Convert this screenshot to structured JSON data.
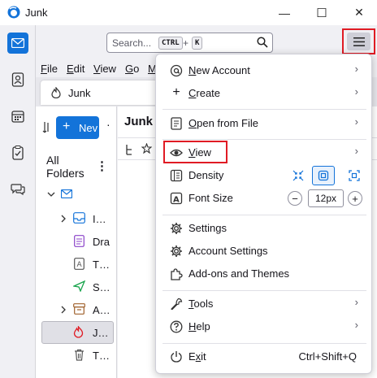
{
  "window": {
    "title": "Junk",
    "minimize_glyph": "—",
    "maximize_glyph": "☐",
    "close_glyph": "✕"
  },
  "search": {
    "placeholder": "Search...",
    "key1": "CTRL",
    "plus": "+",
    "key2": "K"
  },
  "menubar": [
    {
      "label": "File",
      "mnemonic": "F",
      "rest": "ile"
    },
    {
      "label": "Edit",
      "mnemonic": "E",
      "rest": "dit"
    },
    {
      "label": "View",
      "mnemonic": "V",
      "rest": "iew"
    },
    {
      "label": "Go",
      "mnemonic": "G",
      "rest": "o"
    },
    {
      "label": "M",
      "mnemonic": "M",
      "rest": ""
    }
  ],
  "tab": {
    "label": "Junk"
  },
  "folderpane": {
    "new_message": "Nev",
    "all_folders": "All Folders",
    "more": "⋮",
    "dot": "·",
    "folders": [
      {
        "name": "I…",
        "icon": "inbox-icon"
      },
      {
        "name": "Dra",
        "icon": "drafts-icon"
      },
      {
        "name": "T…",
        "icon": "templates-icon"
      },
      {
        "name": "S…",
        "icon": "sent-icon"
      },
      {
        "name": "A…",
        "icon": "archive-icon"
      },
      {
        "name": "J…",
        "icon": "junk-icon"
      },
      {
        "name": "T…",
        "icon": "trash-icon"
      }
    ]
  },
  "thread": {
    "title": "Junk"
  },
  "appmenu": {
    "new_account": {
      "pre": "",
      "mn": "N",
      "post": "ew Account"
    },
    "create": {
      "pre": "",
      "mn": "C",
      "post": "reate"
    },
    "open_from_file": {
      "pre": "",
      "mn": "O",
      "post": "pen from File"
    },
    "view": {
      "pre": "",
      "mn": "V",
      "post": "iew"
    },
    "density": "Density",
    "font_size": "Font Size",
    "font_size_value": "12px",
    "font_minus": "−",
    "font_plus": "+",
    "settings": "Settings",
    "account_settings": "Account Settings",
    "addons": "Add-ons and Themes",
    "tools": {
      "pre": "",
      "mn": "T",
      "post": "ools"
    },
    "help": {
      "pre": "",
      "mn": "H",
      "post": "elp"
    },
    "exit": {
      "pre": "E",
      "mn": "x",
      "post": "it"
    },
    "exit_shortcut": "Ctrl+Shift+Q",
    "chevron": "›"
  }
}
